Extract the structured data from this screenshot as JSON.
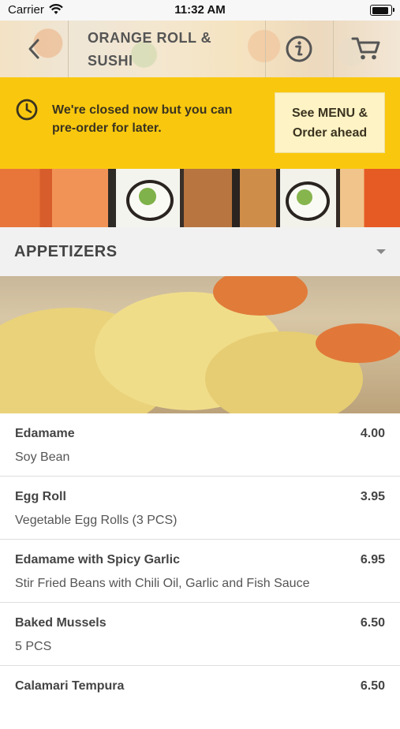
{
  "status_bar": {
    "carrier": "Carrier",
    "time": "11:32 AM"
  },
  "header": {
    "title_line1": "ORANGE ROLL &",
    "title_line2": "SUSHI",
    "back_icon": "chevron-left-icon",
    "info_icon": "info-icon",
    "cart_icon": "cart-icon"
  },
  "banner": {
    "message_line1": "We're closed now but you can",
    "message_line2": "pre-order for later.",
    "button_line1": "See MENU &",
    "button_line2": "Order ahead",
    "icon": "clock-icon",
    "color": "#f9c80e"
  },
  "category": {
    "title": "APPETIZERS",
    "icon": "caret-down-icon"
  },
  "menu": {
    "items": [
      {
        "name": "Edamame",
        "price": "4.00",
        "description": "Soy Bean"
      },
      {
        "name": "Egg Roll",
        "price": "3.95",
        "description": "Vegetable Egg Rolls (3 PCS)"
      },
      {
        "name": "Edamame with Spicy Garlic",
        "price": "6.95",
        "description": "Stir Fried Beans with Chili Oil, Garlic and Fish Sauce"
      },
      {
        "name": "Baked Mussels",
        "price": "6.50",
        "description": "5 PCS"
      },
      {
        "name": "Calamari Tempura",
        "price": "6.50",
        "description": ""
      }
    ]
  }
}
